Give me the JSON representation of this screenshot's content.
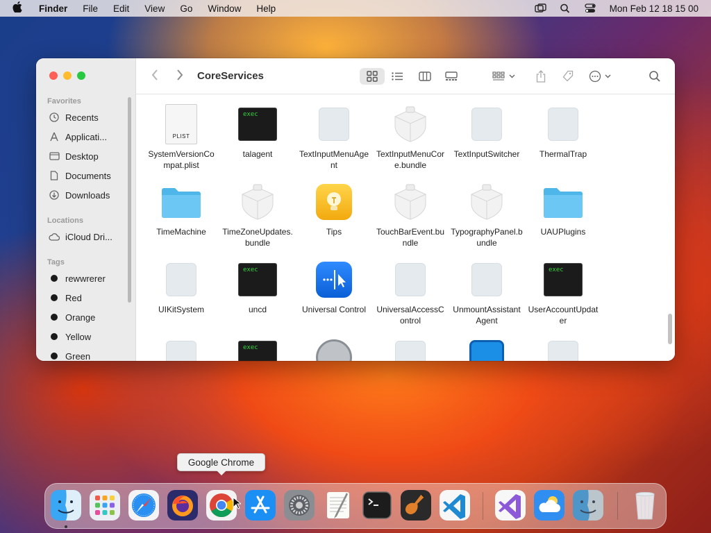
{
  "menubar": {
    "apple": "",
    "app": "Finder",
    "menus": [
      "File",
      "Edit",
      "View",
      "Go",
      "Window",
      "Help"
    ],
    "datetime": "Mon Feb 12  18 15 00"
  },
  "window": {
    "title": "CoreServices",
    "sidebar": {
      "favorites_heading": "Favorites",
      "favorites": [
        "Recents",
        "Applicati...",
        "Desktop",
        "Documents",
        "Downloads"
      ],
      "locations_heading": "Locations",
      "locations": [
        "iCloud Dri..."
      ],
      "tags_heading": "Tags",
      "tags": [
        "rewwrerer",
        "Red",
        "Orange",
        "Yellow",
        "Green"
      ]
    },
    "files": [
      {
        "name": "SystemVersionCompat.plist",
        "kind": "plist"
      },
      {
        "name": "talagent",
        "kind": "exec"
      },
      {
        "name": "TextInputMenuAgent",
        "kind": "generic"
      },
      {
        "name": "TextInputMenuCore.bundle",
        "kind": "bundle"
      },
      {
        "name": "TextInputSwitcher",
        "kind": "generic"
      },
      {
        "name": "ThermalTrap",
        "kind": "generic"
      },
      {
        "name": "TimeMachine",
        "kind": "folder"
      },
      {
        "name": "TimeZoneUpdates.bundle",
        "kind": "bundle"
      },
      {
        "name": "Tips",
        "kind": "tips"
      },
      {
        "name": "TouchBarEvent.bundle",
        "kind": "bundle"
      },
      {
        "name": "TypographyPanel.bundle",
        "kind": "bundle"
      },
      {
        "name": "UAUPlugins",
        "kind": "folder"
      },
      {
        "name": "UIKitSystem",
        "kind": "generic"
      },
      {
        "name": "uncd",
        "kind": "exec"
      },
      {
        "name": "Universal Control",
        "kind": "universal"
      },
      {
        "name": "UniversalAccessControl",
        "kind": "generic"
      },
      {
        "name": "UnmountAssistantAgent",
        "kind": "generic"
      },
      {
        "name": "UserAccountUpdater",
        "kind": "exec"
      },
      {
        "name": "",
        "kind": "generic"
      },
      {
        "name": "",
        "kind": "exec"
      },
      {
        "name": "",
        "kind": "accessibility"
      },
      {
        "name": "",
        "kind": "generic"
      },
      {
        "name": "",
        "kind": "screens"
      },
      {
        "name": "",
        "kind": "generic"
      }
    ],
    "exec_label": "exec",
    "plist_label": "PLIST"
  },
  "tooltip": "Google Chrome",
  "dock": {
    "apps": [
      "Finder",
      "Launchpad",
      "Safari",
      "Firefox",
      "Google Chrome",
      "App Store",
      "System Settings",
      "TextEdit",
      "Terminal",
      "GarageBand",
      "Visual Studio Code",
      "Visual Studio",
      "Weather",
      "Preview",
      "Trash"
    ]
  },
  "colors": {
    "accent": "#007aff",
    "folder": "#5fc4f2",
    "exec_text": "#36d23e",
    "tag_dot": "#1a1a1a"
  }
}
